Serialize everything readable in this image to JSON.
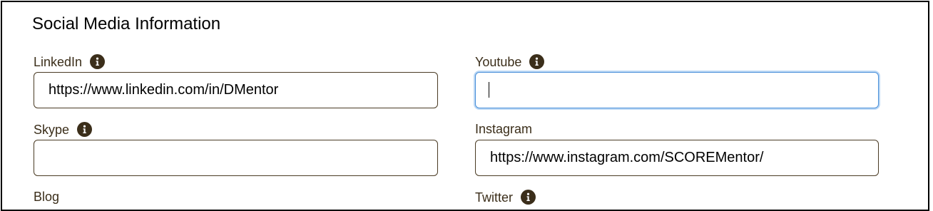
{
  "section": {
    "title": "Social Media Information"
  },
  "fields": {
    "linkedin": {
      "label": "LinkedIn",
      "value": "https://www.linkedin.com/in/DMentor",
      "has_info_icon": true
    },
    "youtube": {
      "label": "Youtube",
      "value": "",
      "has_info_icon": true,
      "focused": true
    },
    "skype": {
      "label": "Skype",
      "value": "",
      "has_info_icon": true
    },
    "instagram": {
      "label": "Instagram",
      "value": "https://www.instagram.com/SCOREMentor/",
      "has_info_icon": false
    },
    "blog": {
      "label": "Blog",
      "has_info_icon": false
    },
    "twitter": {
      "label": "Twitter",
      "has_info_icon": true
    }
  },
  "colors": {
    "label_text": "#3b2e1a",
    "input_border": "#4a3b24",
    "focus_border": "#4a90d9",
    "icon_bg": "#3b2e1a"
  }
}
